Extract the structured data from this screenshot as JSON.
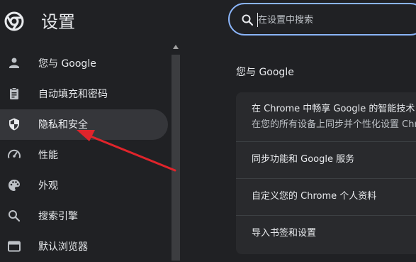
{
  "app": {
    "title": "设置"
  },
  "search": {
    "placeholder": "在设置中搜索",
    "value": ""
  },
  "sidebar": {
    "items": [
      {
        "label": "您与 Google",
        "icon": "person-icon"
      },
      {
        "label": "自动填充和密码",
        "icon": "clipboard-icon"
      },
      {
        "label": "隐私和安全",
        "icon": "shield-icon",
        "active": true
      },
      {
        "label": "性能",
        "icon": "speedometer-icon"
      },
      {
        "label": "外观",
        "icon": "palette-icon"
      },
      {
        "label": "搜索引擎",
        "icon": "search-icon"
      },
      {
        "label": "默认浏览器",
        "icon": "browser-icon"
      }
    ]
  },
  "main": {
    "section_title": "您与 Google",
    "rows": [
      {
        "label": "在 Chrome 中畅享 Google 的智能技术",
        "sublabel": "在您的所有设备上同步并个性化设置 Chrome"
      },
      {
        "label": "同步功能和 Google 服务"
      },
      {
        "label": "自定义您的 Chrome 个人资料"
      },
      {
        "label": "导入书签和设置"
      }
    ]
  },
  "colors": {
    "background": "#202124",
    "card": "#292a2d",
    "active_item": "#35363a",
    "accent": "#8ab4f8",
    "annotation_arrow": "#e0242b"
  }
}
